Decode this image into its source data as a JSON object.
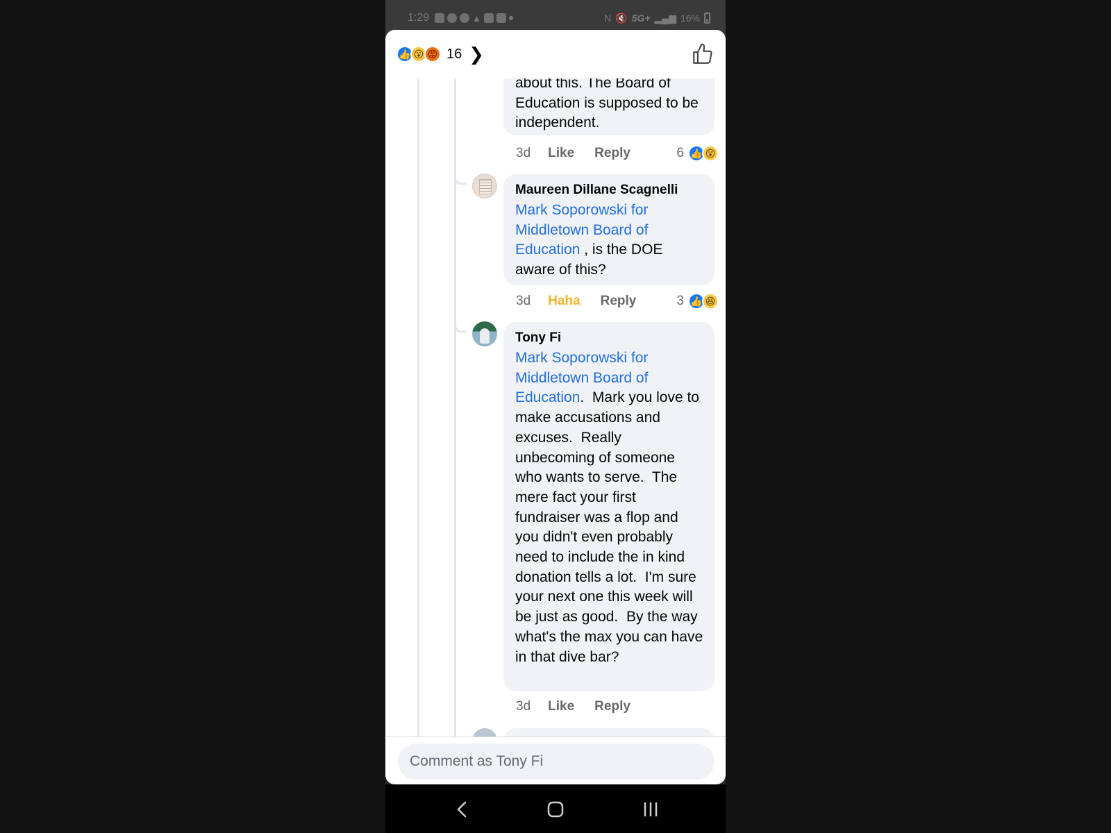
{
  "status_bar": {
    "time": "1:29",
    "network": "5G+",
    "battery": "16%"
  },
  "reactions_header": {
    "count": "16",
    "types": [
      "like",
      "wow",
      "angry"
    ]
  },
  "comments": [
    {
      "text": "about this. The Board of Education is supposed to be independent.",
      "time": "3d",
      "action_primary": "Like",
      "action_reply": "Reply",
      "reaction_count": "6",
      "reactions": [
        "like",
        "wow"
      ]
    },
    {
      "author": "Maureen Dillane Scagnelli",
      "mention": "Mark Soporowski for Middletown Board of Education",
      "text": " , is the DOE aware of this?",
      "time": "3d",
      "action_primary": "Haha",
      "action_reply": "Reply",
      "reaction_count": "3",
      "reactions": [
        "like",
        "haha"
      ]
    },
    {
      "author": "Tony Fi",
      "mention": "Mark Soporowski for Middletown Board of Education",
      "text": ".  Mark you love to make accusations and excuses.  Really unbecoming of someone who wants to serve.  The mere fact your first fundraiser was a flop and you didn't even probably need to include the in kind donation tells a lot.  I'm sure your next one this week will be just as good.  By the way what's the max you can have in that dive bar?",
      "time": "3d",
      "action_primary": "Like",
      "action_reply": "Reply"
    }
  ],
  "composer": {
    "placeholder": "Comment as Tony Fi"
  },
  "colors": {
    "link": "#216fdb",
    "haha_active": "#f0b429",
    "bubble": "#f0f2f5",
    "like_blue": "#1877f2"
  }
}
